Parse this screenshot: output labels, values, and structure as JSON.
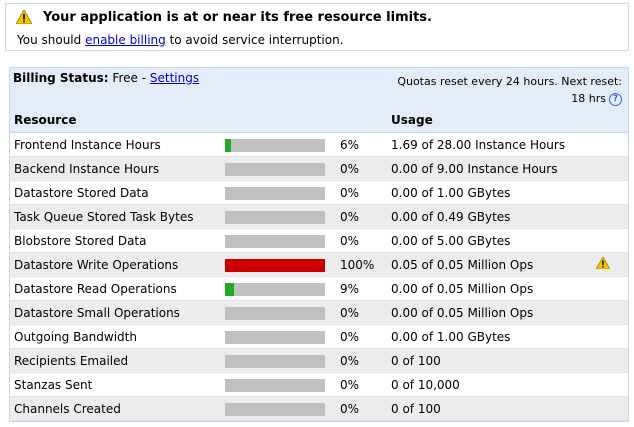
{
  "alert": {
    "title": "Your application is at or near its free resource limits.",
    "prefix": "You should ",
    "link": "enable billing",
    "suffix": " to avoid service interruption."
  },
  "billing": {
    "label": "Billing Status:",
    "status": " Free - ",
    "settings_link": "Settings",
    "reset_line1": "Quotas reset every 24 hours. Next reset:",
    "reset_line2": "18 hrs",
    "help": "?"
  },
  "table": {
    "headers": {
      "resource": "Resource",
      "usage": "Usage"
    },
    "rows": [
      {
        "resource": "Frontend Instance Hours",
        "percent": "6%",
        "fill": 0.06,
        "color": "#22aa22",
        "usage": "1.69 of 28.00 Instance Hours",
        "warn": false
      },
      {
        "resource": "Backend Instance Hours",
        "percent": "0%",
        "fill": 0,
        "color": "#22aa22",
        "usage": "0.00 of 9.00 Instance Hours",
        "warn": false
      },
      {
        "resource": "Datastore Stored Data",
        "percent": "0%",
        "fill": 0,
        "color": "#22aa22",
        "usage": "0.00 of 1.00 GBytes",
        "warn": false
      },
      {
        "resource": "Task Queue Stored Task Bytes",
        "percent": "0%",
        "fill": 0,
        "color": "#22aa22",
        "usage": "0.00 of 0.49 GBytes",
        "warn": false
      },
      {
        "resource": "Blobstore Stored Data",
        "percent": "0%",
        "fill": 0,
        "color": "#22aa22",
        "usage": "0.00 of 5.00 GBytes",
        "warn": false
      },
      {
        "resource": "Datastore Write Operations",
        "percent": "100%",
        "fill": 1.0,
        "color": "#cc0000",
        "usage": "0.05 of 0.05 Million Ops",
        "warn": true
      },
      {
        "resource": "Datastore Read Operations",
        "percent": "9%",
        "fill": 0.09,
        "color": "#22aa22",
        "usage": "0.00 of 0.05 Million Ops",
        "warn": false
      },
      {
        "resource": "Datastore Small Operations",
        "percent": "0%",
        "fill": 0,
        "color": "#22aa22",
        "usage": "0.00 of 0.05 Million Ops",
        "warn": false
      },
      {
        "resource": "Outgoing Bandwidth",
        "percent": "0%",
        "fill": 0,
        "color": "#22aa22",
        "usage": "0.00 of 1.00 GBytes",
        "warn": false
      },
      {
        "resource": "Recipients Emailed",
        "percent": "0%",
        "fill": 0,
        "color": "#22aa22",
        "usage": "0 of 100",
        "warn": false
      },
      {
        "resource": "Stanzas Sent",
        "percent": "0%",
        "fill": 0,
        "color": "#22aa22",
        "usage": "0 of 10,000",
        "warn": false
      },
      {
        "resource": "Channels Created",
        "percent": "0%",
        "fill": 0,
        "color": "#22aa22",
        "usage": "0 of 100",
        "warn": false
      }
    ]
  },
  "icons": {
    "warning": "warning-icon",
    "help": "help-icon"
  }
}
